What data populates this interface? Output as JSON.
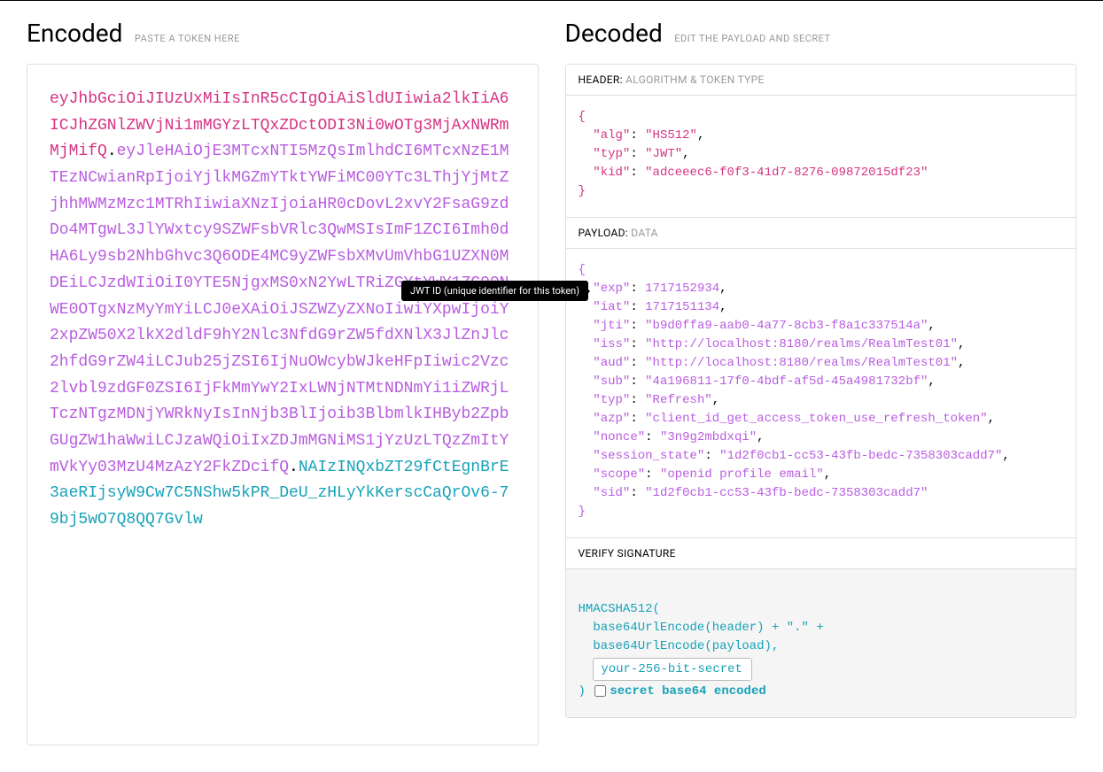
{
  "encoded": {
    "title": "Encoded",
    "subtitle": "PASTE A TOKEN HERE",
    "token": {
      "header": "eyJhbGciOiJIUzUxMiIsInR5cCIgOiAiSldUIiwia2lkIiA6ICJhZGNlZWVjNi1mMGYzLTQxZDctODI3Ni0wOTg3MjAxNWRmMjMifQ",
      "payload": "eyJleHAiOjE3MTcxNTI5MzQsImlhdCI6MTcxNzE1MTEzNCwianRpIjoiYjlkMGZmYTktYWFiMC00YTc3LThjYjMtZjhhMWMzMzc1MTRhIiwiaXNzIjoiaHR0cDovL2xvY2FsaG9zdDo4MTgwL3JlYWxtcy9SZWFsbVRlc3QwMSIsImF1ZCI6Imh0dHA6Ly9sb2NhbGhvc3Q6ODE4MC9yZWFsbXMvUmVhbG1UZXN0MDEiLCJzdWIiOiI0YTE5NjgxMS0xN2YwLTRiZGYtYWY1ZC00NWE0OTgxNzMyYmYiLCJ0eXAiOiJSZWZyZXNoIiwiYXpwIjoiY2xpZW50X2lkX2dldF9hY2Nlc3NfdG9rZW5fdXNlX3JlZnJlc2hfdG9rZW4iLCJub25jZSI6IjNuOWcybWJkeHFpIiwic2Vzc2lvbl9zdGF0ZSI6IjFkMmYwY2IxLWNjNTMtNDNmYi1iZWRjLTczNTgzMDNjYWRkNyIsInNjb3BlIjoib3BlbmlkIHByb2ZpbGUgZW1haWwiLCJzaWQiOiIxZDJmMGNiMS1jYzUzLTQzZmItYmVkYy03MzU4MzAzY2FkZDcifQ",
      "signature": "NAIzINQxbZT29fCtEgnBrE3aeRIjsyW9Cw7C5NShw5kPR_DeU_zHLyYkKerscCaQrOv6-79bj5wO7Q8QQ7Gvlw"
    },
    "tooltip": "JWT ID (unique identifier for this token)"
  },
  "decoded": {
    "title": "Decoded",
    "subtitle": "EDIT THE PAYLOAD AND SECRET",
    "header_section": {
      "label": "HEADER:",
      "desc": "ALGORITHM & TOKEN TYPE",
      "json": {
        "alg": "HS512",
        "typ": "JWT",
        "kid": "adceeec6-f0f3-41d7-8276-09872015df23"
      }
    },
    "payload_section": {
      "label": "PAYLOAD:",
      "desc": "DATA",
      "json": {
        "exp": 1717152934,
        "iat": 1717151134,
        "jti": "b9d0ffa9-aab0-4a77-8cb3-f8a1c337514a",
        "iss": "http://localhost:8180/realms/RealmTest01",
        "aud": "http://localhost:8180/realms/RealmTest01",
        "sub": "4a196811-17f0-4bdf-af5d-45a4981732bf",
        "typ": "Refresh",
        "azp": "client_id_get_access_token_use_refresh_token",
        "nonce": "3n9g2mbdxqi",
        "session_state": "1d2f0cb1-cc53-43fb-bedc-7358303cadd7",
        "scope": "openid profile email",
        "sid": "1d2f0cb1-cc53-43fb-bedc-7358303cadd7"
      }
    },
    "signature_section": {
      "label": "VERIFY SIGNATURE",
      "algo": "HMACSHA512(",
      "line1": "base64UrlEncode(header) + \".\" +",
      "line2": "base64UrlEncode(payload),",
      "secret_placeholder": "your-256-bit-secret",
      "close": ")",
      "checkbox_label": "secret base64 encoded"
    }
  }
}
